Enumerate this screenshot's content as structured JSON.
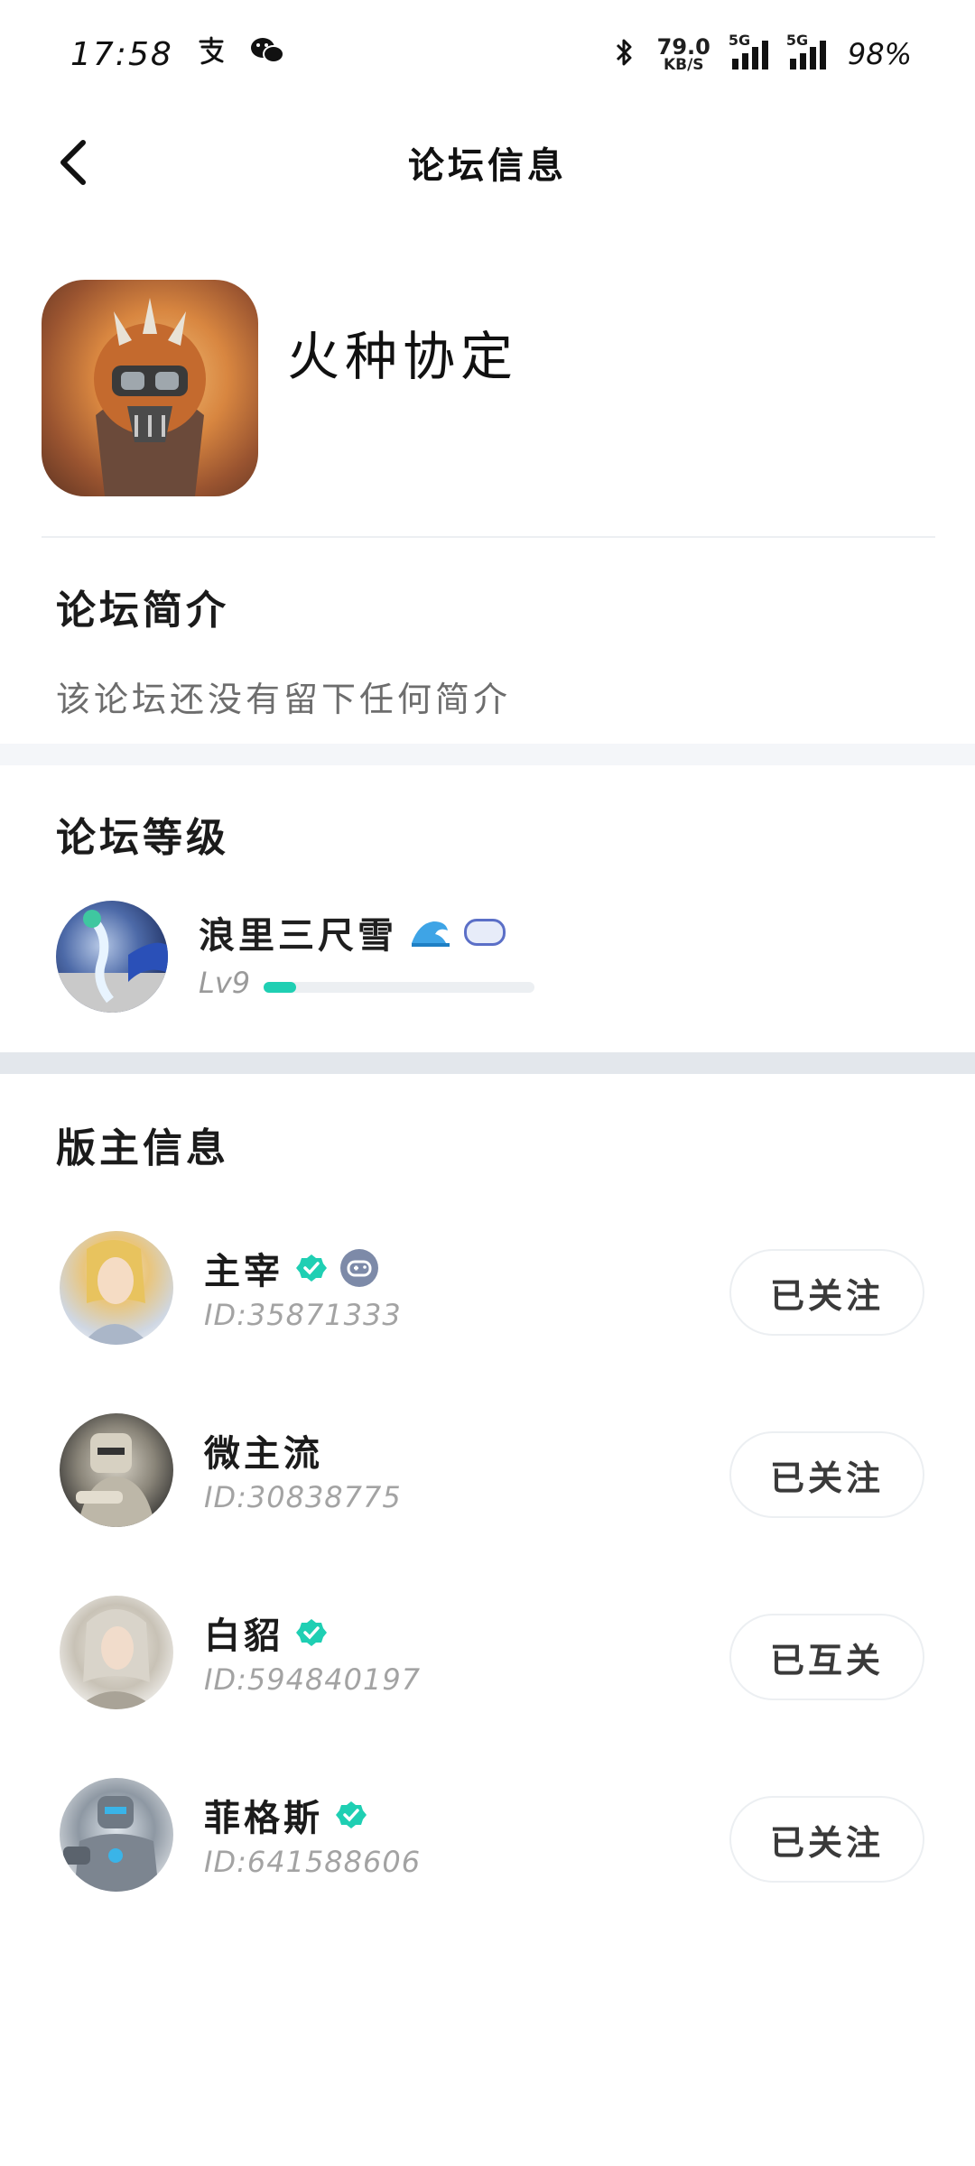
{
  "status_bar": {
    "time": "17:58",
    "app_icons": [
      "alipay-icon",
      "wechat-icon"
    ],
    "net_speed_value": "79.0",
    "net_speed_unit": "KB/S",
    "signal_1_label": "5G",
    "signal_2_label": "5G",
    "battery": "98%"
  },
  "nav": {
    "title": "论坛信息",
    "back_icon": "chevron-left-icon"
  },
  "forum": {
    "name": "火种协定"
  },
  "intro": {
    "title": "论坛简介",
    "text": "该论坛还没有留下任何简介"
  },
  "level": {
    "title": "论坛等级",
    "user_name": "浪里三尺雪",
    "level_label": "Lv9",
    "progress_fraction": 0.12,
    "accent_color": "#1fcfb3"
  },
  "moderators": {
    "title": "版主信息",
    "items": [
      {
        "name": "主宰",
        "id": "ID:35871333",
        "button": "已关注",
        "verified": true,
        "gamepad_badge": true
      },
      {
        "name": "微主流",
        "id": "ID:30838775",
        "button": "已关注",
        "verified": false,
        "gamepad_badge": false
      },
      {
        "name": "白貂",
        "id": "ID:594840197",
        "button": "已互关",
        "verified": true,
        "gamepad_badge": false
      },
      {
        "name": "菲格斯",
        "id": "ID:641588606",
        "button": "已关注",
        "verified": true,
        "gamepad_badge": false
      }
    ]
  },
  "colors": {
    "verified": "#1fcfb3",
    "section_band": "#f4f6f9",
    "text_secondary": "#a3a3a3"
  }
}
